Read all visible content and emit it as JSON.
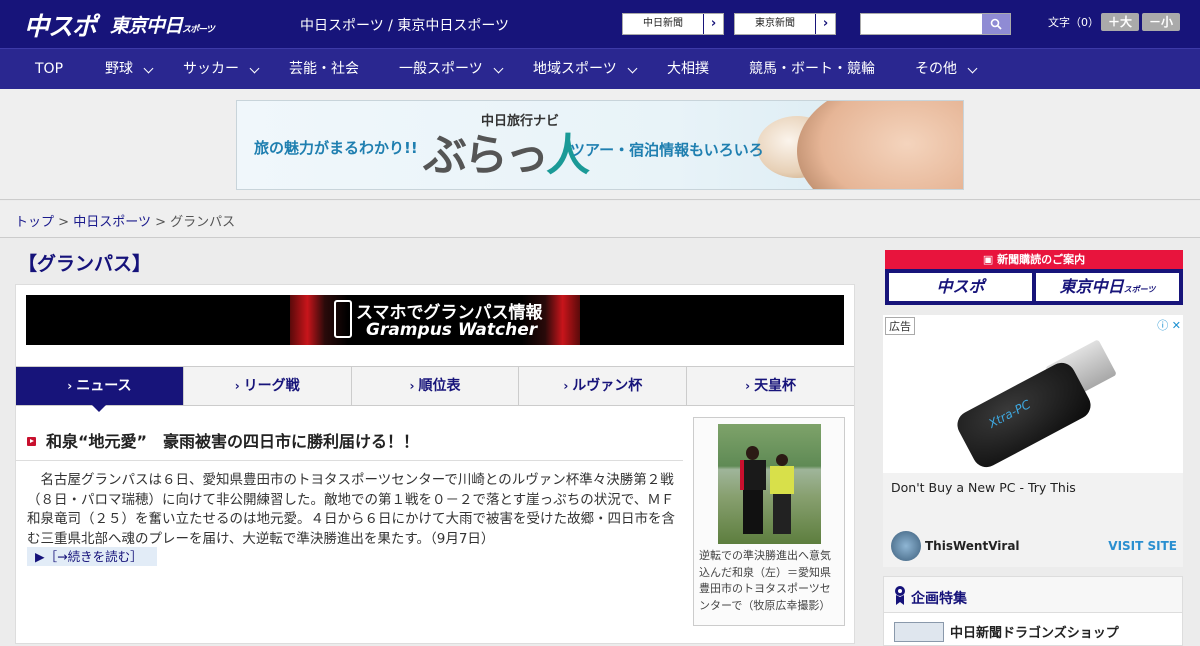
{
  "header": {
    "logo_chuspo": "中スポ",
    "logo_tokyo": "東京中日",
    "logo_tokyo_small": "スポーツ",
    "site_name": "中日スポーツ / 東京中日スポーツ",
    "links": [
      "中日新聞",
      "東京新聞"
    ],
    "search": {
      "placeholder": "",
      "icon": "search-icon"
    },
    "font_size_label": "文字（0）",
    "font_larger": "＋大",
    "font_smaller": "－小"
  },
  "nav": {
    "items": [
      {
        "label": "TOP",
        "dropdown": false
      },
      {
        "label": "野球",
        "dropdown": true
      },
      {
        "label": "サッカー",
        "dropdown": true
      },
      {
        "label": "芸能・社会",
        "dropdown": false
      },
      {
        "label": "一般スポーツ",
        "dropdown": true
      },
      {
        "label": "地域スポーツ",
        "dropdown": true
      },
      {
        "label": "大相撲",
        "dropdown": false
      },
      {
        "label": "競馬・ボート・競輪",
        "dropdown": false
      },
      {
        "label": "その他",
        "dropdown": true
      }
    ]
  },
  "top_banner": {
    "small": "中日旅行ナビ",
    "left": "旅の魅力がまるわかり!!",
    "brand_a": "ぶらっ",
    "brand_b": "人",
    "right": "ツアー・宿泊情報もいろいろ"
  },
  "breadcrumb": {
    "home": "トップ",
    "section": "中日スポーツ",
    "current": "グランパス",
    "sep": ">"
  },
  "page_title": "【グランパス】",
  "promo": {
    "line1": "スマホでグランパス情報",
    "line2": "Grampus Watcher"
  },
  "tabs": [
    {
      "label": "ニュース",
      "active": true
    },
    {
      "label": "リーグ戦",
      "active": false
    },
    {
      "label": "順位表",
      "active": false
    },
    {
      "label": "ルヴァン杯",
      "active": false
    },
    {
      "label": "天皇杯",
      "active": false
    }
  ],
  "article": {
    "headline": "和泉“地元愛”　豪雨被害の四日市に勝利届ける！！",
    "body": "名古屋グランパスは６日、愛知県豊田市のトヨタスポーツセンターで川崎とのルヴァン杯準々決勝第２戦（８日・パロマ瑞穂）に向けて非公開練習した。敵地での第１戦を０－２で落とす崖っぷちの状況で、ＭＦ和泉竜司（２５）を奮い立たせるのは地元愛。４日から６日にかけて大雨で被害を受けた故郷・四日市を含む三重県北部へ魂のプレーを届け、大逆転で準決勝進出を果たす。（9月7日）",
    "read_more": "［→続きを読む］",
    "caption": "逆転での準決勝進出へ意気込んだ和泉（左）＝愛知県豊田市のトヨタスポーツセンターで（牧原広幸撮影）"
  },
  "sidebar": {
    "subscribe_head": "新聞購読のご案内",
    "subscribe_buttons": [
      "中スポ",
      "東京中日"
    ],
    "subscribe_small": "スポーツ",
    "ad": {
      "label": "広告",
      "title": "Don't Buy a New PC - Try This",
      "source": "ThisWentViral",
      "cta": "VISIT SITE",
      "product_text": "Xtra-PC"
    },
    "feature_title": "企画特集",
    "feature_item": "中日新聞ドラゴンズショップ"
  },
  "colors": {
    "header_bg": "#17147a",
    "nav_bg": "#2a2790",
    "accent_red": "#e8143d",
    "link": "#1a1a8c"
  }
}
